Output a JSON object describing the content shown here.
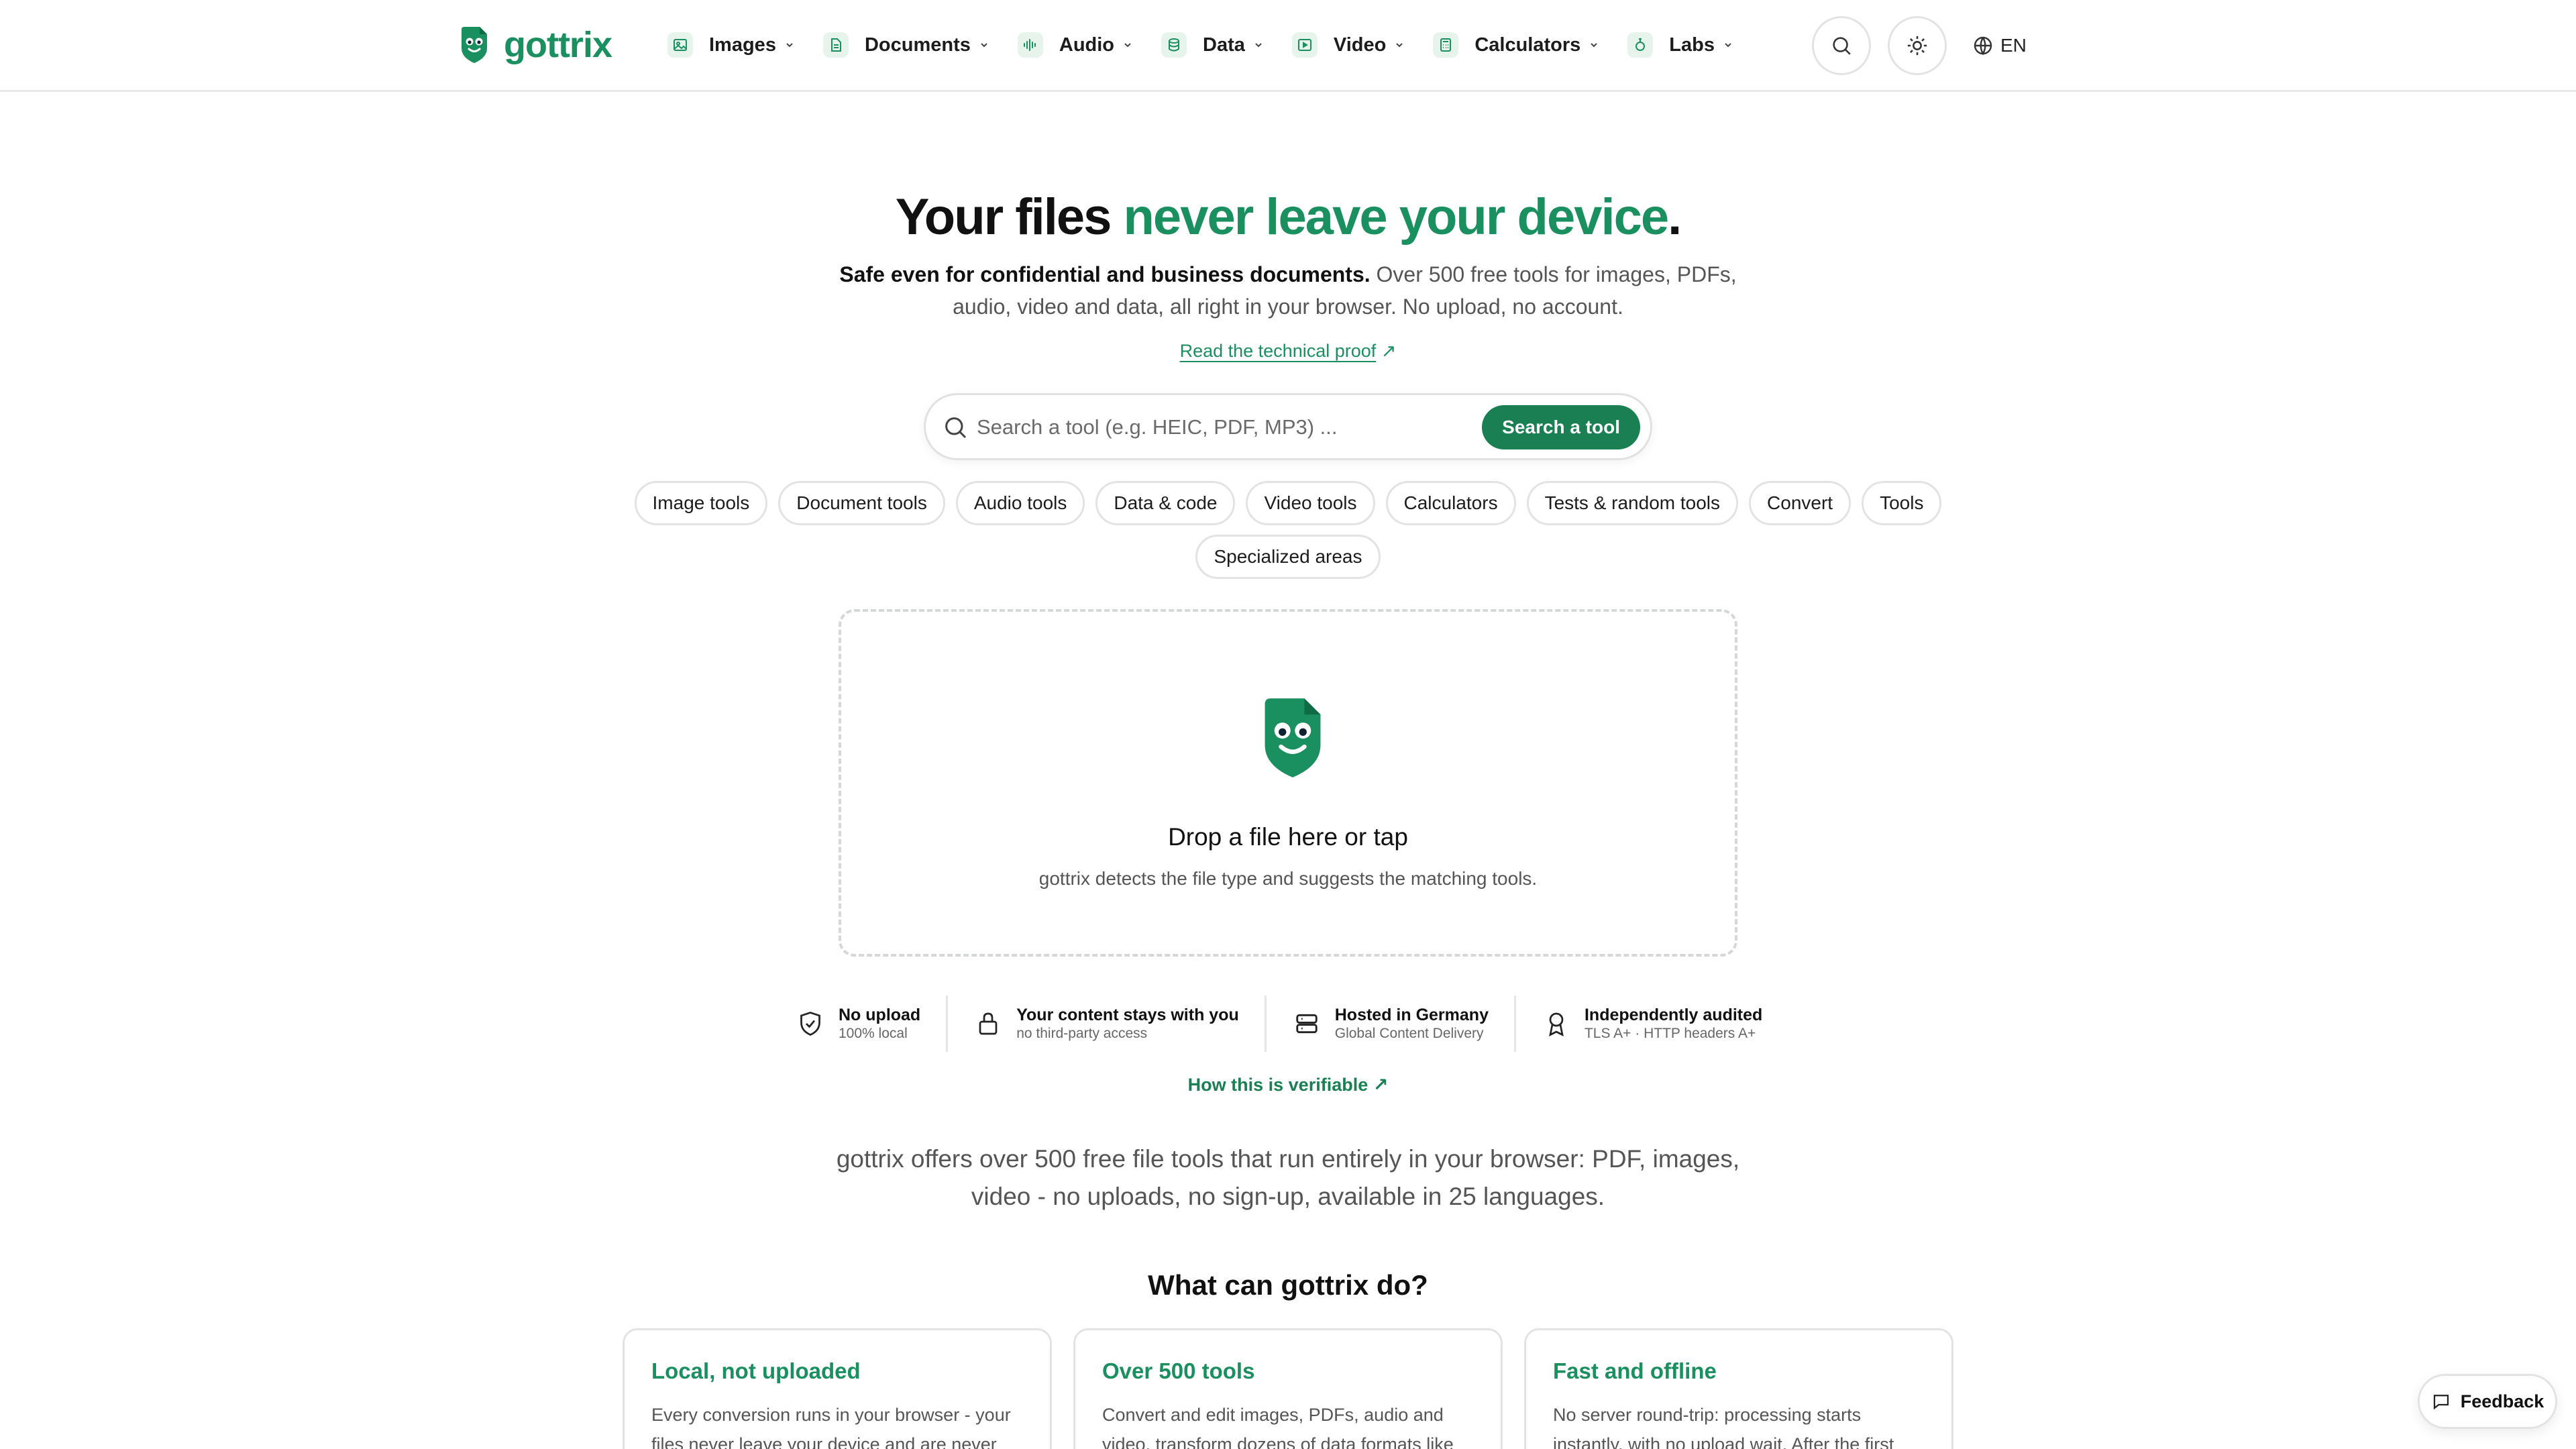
{
  "brand": {
    "name": "gottrix",
    "accent_color": "#1a8f5f",
    "button_color": "#1a7f52"
  },
  "nav": {
    "items": [
      {
        "label": "Images",
        "icon": "image-icon"
      },
      {
        "label": "Documents",
        "icon": "document-icon"
      },
      {
        "label": "Audio",
        "icon": "audio-wave-icon"
      },
      {
        "label": "Data",
        "icon": "database-icon"
      },
      {
        "label": "Video",
        "icon": "video-icon"
      },
      {
        "label": "Calculators",
        "icon": "calculator-icon"
      },
      {
        "label": "Labs",
        "icon": "flask-icon"
      }
    ],
    "search_icon": "search-icon",
    "theme_icon": "sun-icon",
    "language": "EN"
  },
  "hero": {
    "title_main": "Your files ",
    "title_accent": "never leave your device",
    "title_end": ".",
    "subtitle_bold": "Safe even for confidential and business documents.",
    "subtitle_rest": " Over 500 free tools for images, PDFs, audio, video and data, all right in your browser. No upload, no account.",
    "proof_link": "Read the technical proof",
    "proof_arrow": "↗"
  },
  "search": {
    "placeholder": "Search a tool (e.g. HEIC, PDF, MP3) ...",
    "button_label": "Search a tool"
  },
  "chips": [
    "Image tools",
    "Document tools",
    "Audio tools",
    "Data & code",
    "Video tools",
    "Calculators",
    "Tests & random tools",
    "Convert",
    "Tools",
    "Specialized areas"
  ],
  "dropzone": {
    "title": "Drop a file here or tap",
    "subtitle": "gottrix detects the file type and suggests the matching tools."
  },
  "trust": [
    {
      "title": "No upload",
      "sub": "100% local",
      "icon": "shield-check-icon"
    },
    {
      "title": "Your content stays with you",
      "sub": "no third-party access",
      "icon": "lock-icon"
    },
    {
      "title": "Hosted in Germany",
      "sub": "Global Content Delivery",
      "icon": "server-icon"
    },
    {
      "title": "Independently audited",
      "sub": "TLS A+ · HTTP headers A+",
      "icon": "award-icon"
    }
  ],
  "verify_link": "How this is verifiable",
  "verify_arrow": "↗",
  "intro": "gottrix offers over 500 free file tools that run entirely in your browser: PDF, images, video - no uploads, no sign-up, available in 25 languages.",
  "section_title": "What can gottrix do?",
  "cards": [
    {
      "title": "Local, not uploaded",
      "body": "Every conversion runs in your browser - your files never leave your device and are never"
    },
    {
      "title": "Over 500 tools",
      "body": "Convert and edit images, PDFs, audio and video, transform dozens of data formats like"
    },
    {
      "title": "Fast and offline",
      "body": "No server round-trip: processing starts instantly, with no upload wait. After the first"
    }
  ],
  "feedback": {
    "label": "Feedback",
    "icon": "message-icon"
  }
}
